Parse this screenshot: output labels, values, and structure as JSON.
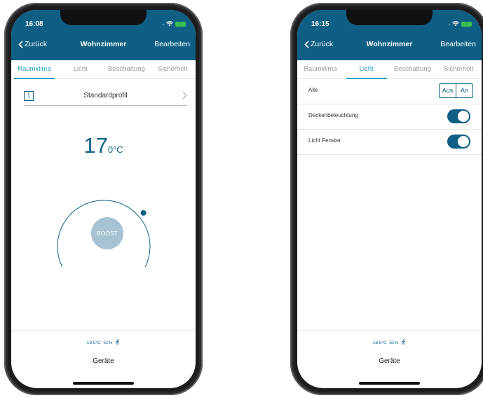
{
  "left_phone": {
    "status": {
      "time": "16:08",
      "battery": "low"
    },
    "nav": {
      "back_label": "Zurück",
      "title": "Wohnzimmer",
      "edit_label": "Bearbeiten"
    },
    "tabs": [
      {
        "label": "Raumklima",
        "active": true
      },
      {
        "label": "Licht",
        "active": false
      },
      {
        "label": "Beschattung",
        "active": false
      },
      {
        "label": "Sicherheit",
        "active": false
      }
    ],
    "profile": {
      "number": "1",
      "name": "Standardprofil"
    },
    "temperature": {
      "value": "17",
      "unit": "0°C"
    },
    "boost_label": "BOOST",
    "climate": {
      "temperature": "18.5°C",
      "humidity": "51%"
    },
    "devices_label": "Geräte"
  },
  "right_phone": {
    "status": {
      "time": "16:15",
      "battery": "low"
    },
    "nav": {
      "back_label": "Zurück",
      "title": "Wohnzimmer",
      "edit_label": "Bearbeiten"
    },
    "tabs": [
      {
        "label": "Raumklima",
        "active": false
      },
      {
        "label": "Licht",
        "active": true
      },
      {
        "label": "Beschattung",
        "active": false
      },
      {
        "label": "Sicherheit",
        "active": false
      }
    ],
    "all_row": {
      "label": "Alle",
      "off_label": "Aus",
      "on_label": "An"
    },
    "lights": [
      {
        "label": "Deckenbeleuchtung",
        "on": true
      },
      {
        "label": "Licht Fenster",
        "on": true
      }
    ],
    "climate": {
      "temperature": "18.5°C",
      "humidity": "51%"
    },
    "devices_label": "Geräte"
  },
  "colors": {
    "primary": "#0f5f84",
    "accent_tab": "#22a0c4",
    "boost": "#a6c2d3",
    "battery": "#38c24e"
  }
}
